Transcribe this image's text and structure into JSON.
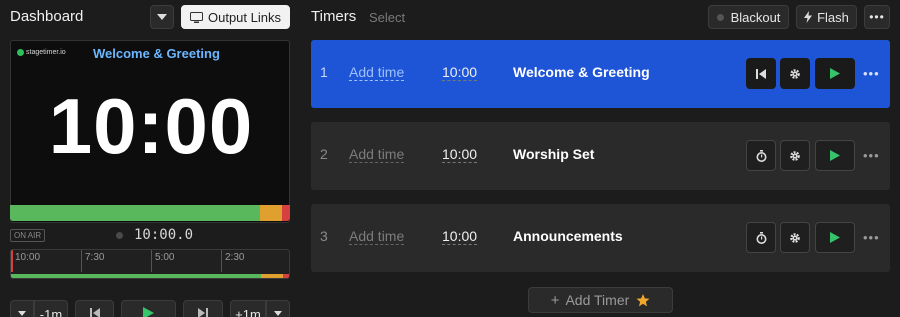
{
  "header": {
    "title": "Dashboard",
    "output_links_label": "Output Links",
    "timers_title": "Timers",
    "select_label": "Select",
    "blackout_label": "Blackout",
    "flash_label": "Flash"
  },
  "preview": {
    "logo_text": "stagetimer.io",
    "title": "Welcome & Greeting",
    "time": "10:00"
  },
  "status": {
    "on_air_label": "ON AIR",
    "clock": "10:00.0"
  },
  "scrubber": {
    "ticks": [
      "10:00",
      "7:30",
      "5:00",
      "2:30"
    ]
  },
  "transport": {
    "minus_label": "-1m",
    "plus_label": "+1m"
  },
  "timers": [
    {
      "num": "1",
      "add_time": "Add time",
      "duration": "10:00",
      "name": "Welcome & Greeting",
      "active": true
    },
    {
      "num": "2",
      "add_time": "Add time",
      "duration": "10:00",
      "name": "Worship Set",
      "active": false
    },
    {
      "num": "3",
      "add_time": "Add time",
      "duration": "10:00",
      "name": "Announcements",
      "active": false
    }
  ],
  "add_timer_label": "Add Timer",
  "colors": {
    "accent": "#1e54d6",
    "green": "#5ab85c",
    "amber": "#e0a030",
    "red": "#d64040",
    "play_green": "#35c46a"
  }
}
